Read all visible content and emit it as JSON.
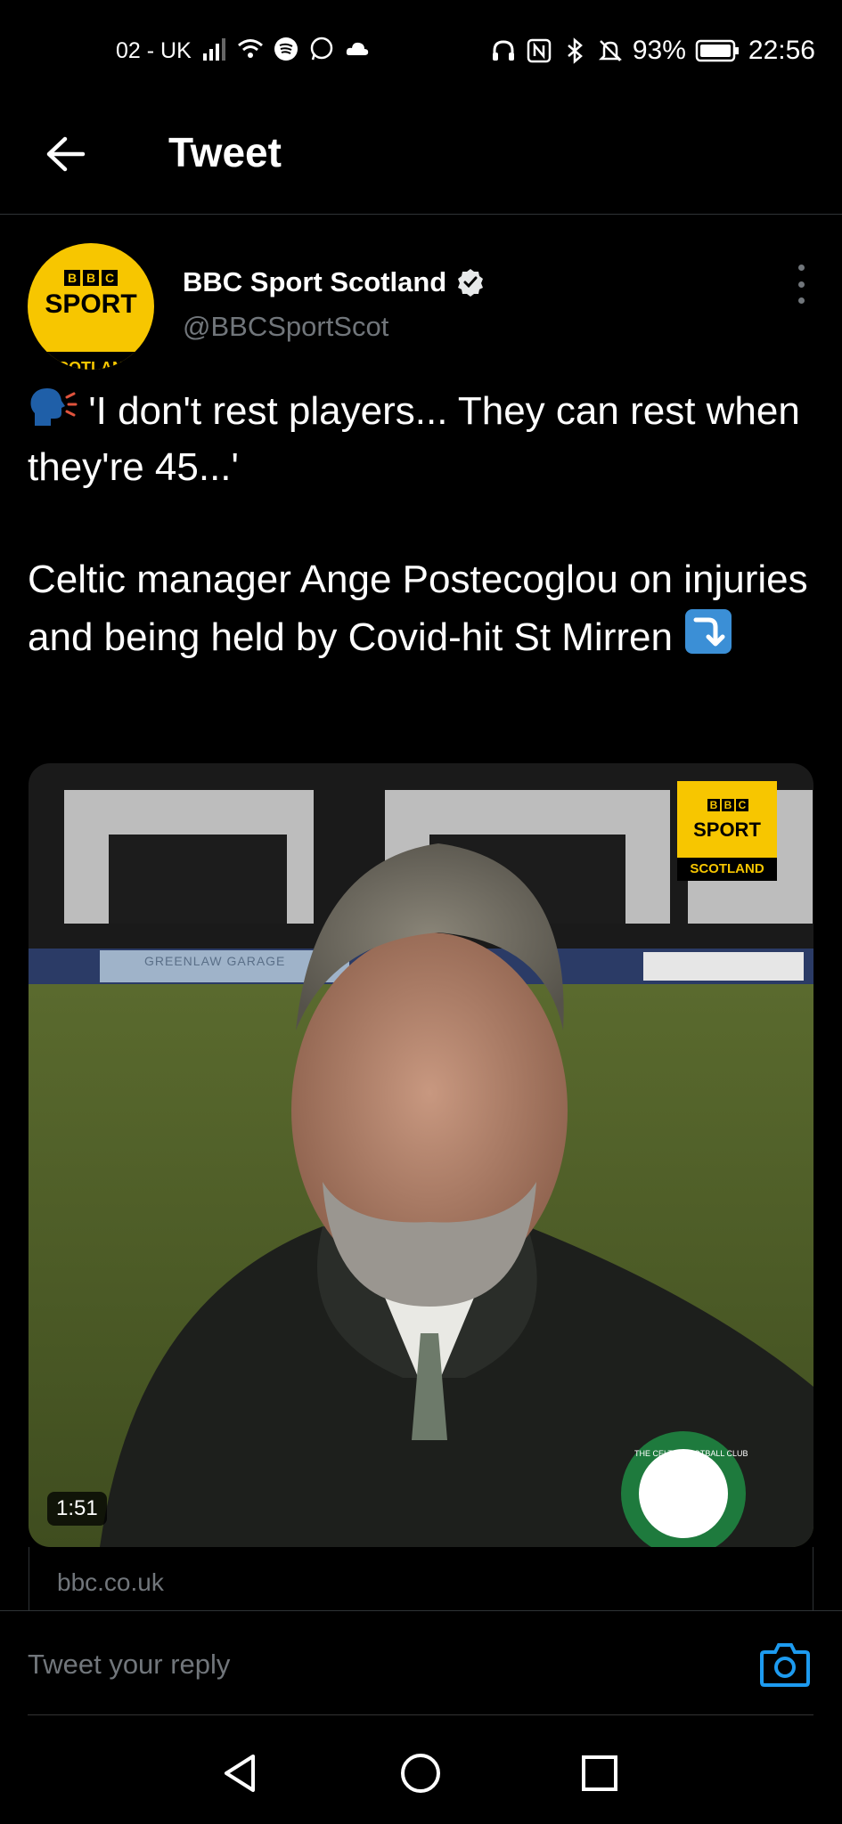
{
  "status_bar": {
    "carrier": "02 - UK",
    "battery": "93%",
    "time": "22:56",
    "left_icons": [
      "signal-icon",
      "wifi-icon",
      "spotify-icon",
      "whatsapp-icon",
      "cloud-icon"
    ],
    "right_icons": [
      "headphones-icon",
      "nfc-icon",
      "bluetooth-icon",
      "mute-icon",
      "battery-icon"
    ]
  },
  "header": {
    "title": "Tweet"
  },
  "tweet": {
    "display_name": "BBC Sport Scotland",
    "handle": "@BBCSportScot",
    "verified": true,
    "avatar": {
      "bbc_letters": [
        "B",
        "B",
        "C"
      ],
      "sport": "SPORT",
      "region": "SCOTLAND"
    },
    "text_line1": "'I don't rest players... They can rest when they're 45...'",
    "text_line2": "Celtic manager Ange Postecoglou on injuries and being held by Covid-hit St Mirren",
    "emoji_1": "speaking-head-icon",
    "emoji_2": "arrow-right-hook-down-icon"
  },
  "media": {
    "duration": "1:51",
    "watermark_bbc": [
      "B",
      "B",
      "C"
    ],
    "watermark_sport": "SPORT",
    "watermark_region": "SCOTLAND",
    "sign_text": "GREENLAW GARAGE",
    "crest_text": "THE CELTIC FOOTBALL CLUB"
  },
  "card": {
    "domain": "bbc.co.uk"
  },
  "reply": {
    "placeholder": "Tweet your reply"
  },
  "colors": {
    "background": "#000000",
    "secondary_text": "#71767b",
    "accent": "#1d9bf0",
    "bbc_yellow": "#f7c600"
  }
}
